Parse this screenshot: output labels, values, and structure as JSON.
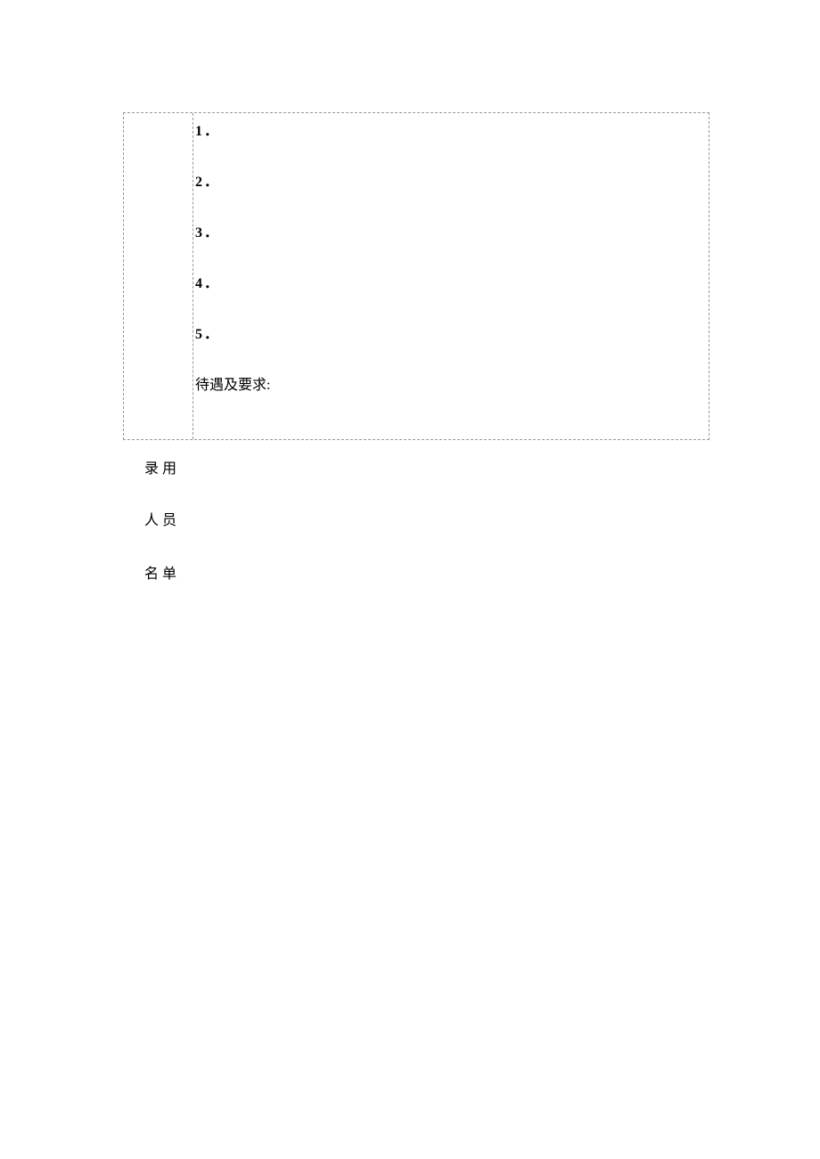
{
  "table": {
    "items": [
      "1．",
      "2．",
      "3．",
      "4．",
      "5．"
    ],
    "requirements_label": "待遇及要求:"
  },
  "below_labels": {
    "line1": "录用",
    "line2": "人员",
    "line3": "名单"
  }
}
